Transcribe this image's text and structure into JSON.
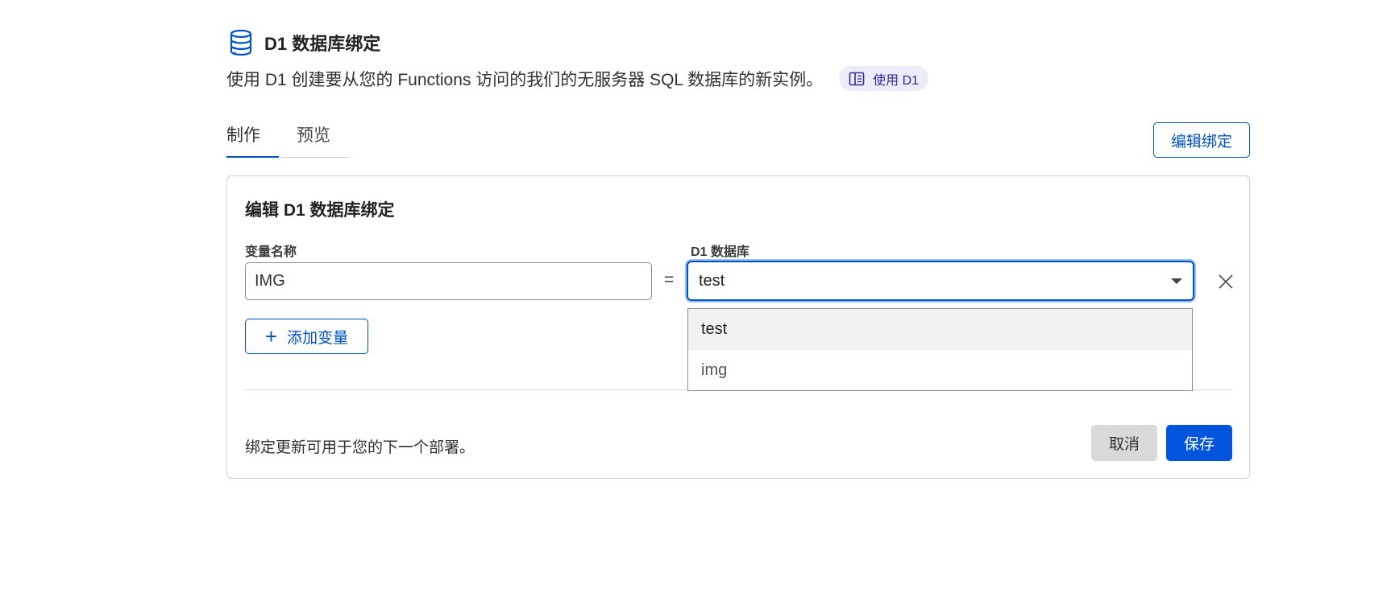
{
  "header": {
    "icon": "database-icon",
    "title": "D1 数据库绑定",
    "description": "使用 D1 创建要从您的 Functions 访问的我们的无服务器 SQL 数据库的新实例。",
    "doc_link": {
      "icon": "book-icon",
      "label": "使用 D1"
    }
  },
  "tabs": [
    {
      "label": "制作",
      "active": true
    },
    {
      "label": "预览",
      "active": false
    }
  ],
  "edit_binding_button": "编辑绑定",
  "panel": {
    "title": "编辑 D1 数据库绑定",
    "variable_label": "变量名称",
    "variable_value": "IMG",
    "equals": "=",
    "database_label": "D1 数据库",
    "database_selected": "test",
    "database_options": [
      "test",
      "img"
    ],
    "remove_icon": "close-icon",
    "add_variable_button": "添加变量",
    "footer_note": "绑定更新可用于您的下一个部署。",
    "cancel_button": "取消",
    "save_button": "保存"
  },
  "colors": {
    "accent": "#0051c3",
    "primary_button": "#0055dc",
    "secondary_button": "#d9d9d9",
    "badge_bg": "#ececf8"
  }
}
